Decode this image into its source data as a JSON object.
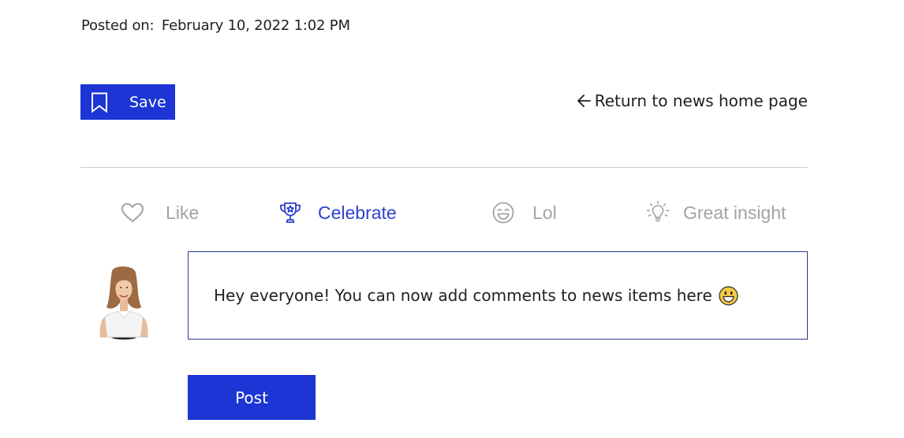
{
  "post": {
    "posted_label": "Posted on:",
    "posted_date": "February 10, 2022 1:02 PM"
  },
  "actions": {
    "save_label": "Save",
    "return_label": "Return to news home page"
  },
  "reactions": [
    {
      "label": "Like",
      "icon": "heart-icon",
      "active": false
    },
    {
      "label": "Celebrate",
      "icon": "trophy-icon",
      "active": true
    },
    {
      "label": "Lol",
      "icon": "laughing-face-icon",
      "active": false
    },
    {
      "label": "Great insight",
      "icon": "lightbulb-icon",
      "active": false
    }
  ],
  "comment": {
    "text": "Hey everyone! You can now add comments to news items here",
    "emoji_icon": "grinning-face-icon",
    "post_label": "Post"
  },
  "colors": {
    "accent": "#1c35d4",
    "active_reaction": "#2b41cc",
    "inactive_reaction": "#a3a3a3"
  }
}
